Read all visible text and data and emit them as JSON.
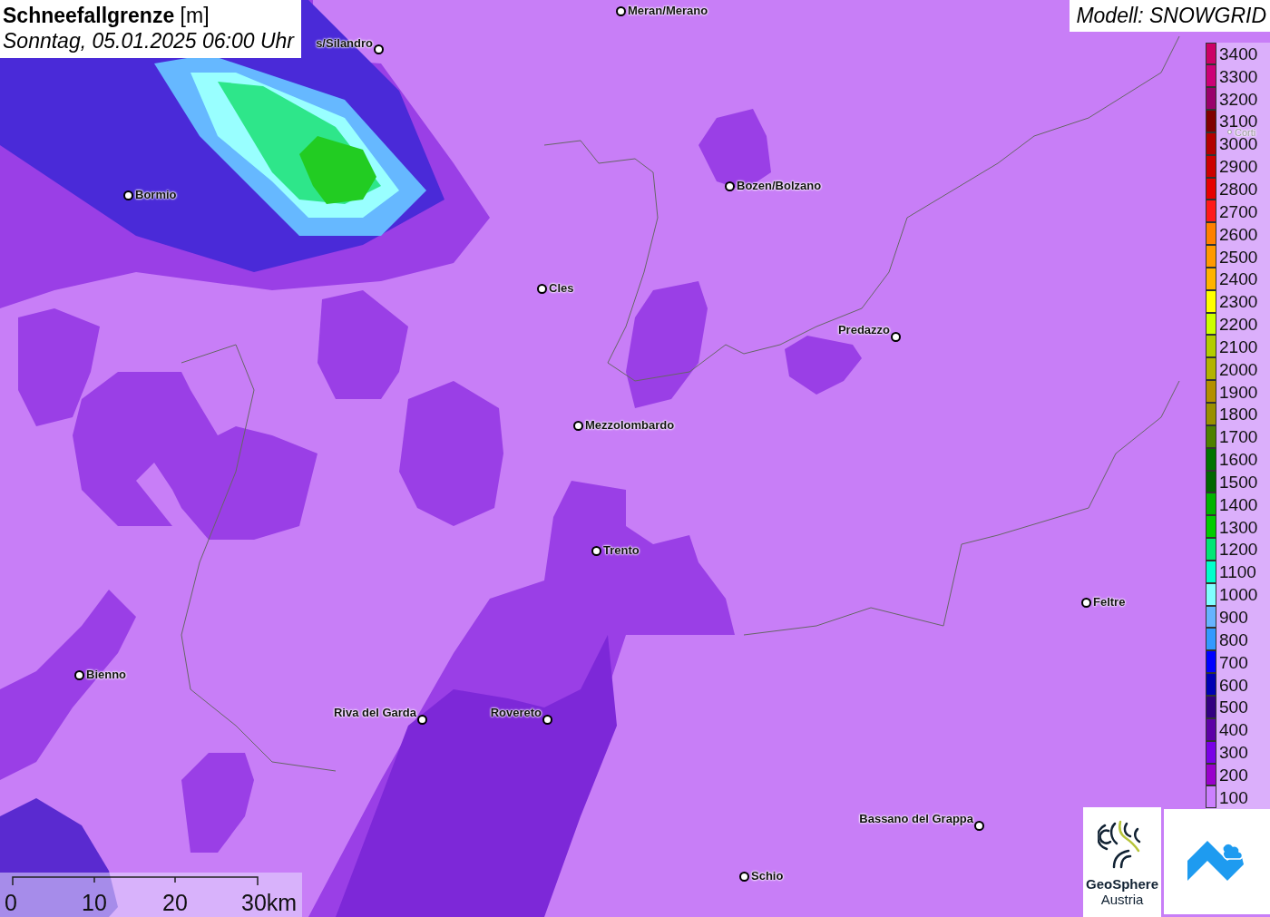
{
  "title": {
    "heading": "**Schneefallgrenze** [m]",
    "datetime": "Sonntag, 05.01.2025 06:00 Uhr"
  },
  "model": "Modell: SNOWGRID",
  "cities": [
    {
      "name": "Meran/Merano"
    },
    {
      "name": "s/Silandro"
    },
    {
      "name": "Bormio"
    },
    {
      "name": "Bozen/Bolzano"
    },
    {
      "name": "Cles"
    },
    {
      "name": "Predazzo"
    },
    {
      "name": "Mezzolombardo"
    },
    {
      "name": "Trento"
    },
    {
      "name": "Feltre"
    },
    {
      "name": "Bienno"
    },
    {
      "name": "Riva del Garda"
    },
    {
      "name": "Rovereto"
    },
    {
      "name": "Bassano del Grappa"
    },
    {
      "name": "Schio"
    },
    {
      "name": "Corti"
    }
  ],
  "legend": [
    {
      "label": "3400",
      "color": "#cc0066"
    },
    {
      "label": "3300",
      "color": "#cc0077"
    },
    {
      "label": "3200",
      "color": "#99006b"
    },
    {
      "label": "3100",
      "color": "#800000"
    },
    {
      "label": "3000",
      "color": "#b30000"
    },
    {
      "label": "2900",
      "color": "#cc0000"
    },
    {
      "label": "2800",
      "color": "#e60000"
    },
    {
      "label": "2700",
      "color": "#ff1a1a"
    },
    {
      "label": "2600",
      "color": "#ff8000"
    },
    {
      "label": "2500",
      "color": "#ff9900"
    },
    {
      "label": "2400",
      "color": "#ffb300"
    },
    {
      "label": "2300",
      "color": "#ffff00"
    },
    {
      "label": "2200",
      "color": "#ccff00"
    },
    {
      "label": "2100",
      "color": "#b3cc00"
    },
    {
      "label": "2000",
      "color": "#b3b300"
    },
    {
      "label": "1900",
      "color": "#b38f00"
    },
    {
      "label": "1800",
      "color": "#998f00"
    },
    {
      "label": "1700",
      "color": "#4d8000"
    },
    {
      "label": "1600",
      "color": "#007300"
    },
    {
      "label": "1500",
      "color": "#006600"
    },
    {
      "label": "1400",
      "color": "#00b300"
    },
    {
      "label": "1300",
      "color": "#00cc00"
    },
    {
      "label": "1200",
      "color": "#00e676"
    },
    {
      "label": "1100",
      "color": "#00ffcc"
    },
    {
      "label": "1000",
      "color": "#80ffff"
    },
    {
      "label": "900",
      "color": "#66b3ff"
    },
    {
      "label": "800",
      "color": "#3399ff"
    },
    {
      "label": "700",
      "color": "#0000ff"
    },
    {
      "label": "600",
      "color": "#0000b3"
    },
    {
      "label": "500",
      "color": "#330080"
    },
    {
      "label": "400",
      "color": "#5c00a6"
    },
    {
      "label": "300",
      "color": "#7a00e6"
    },
    {
      "label": "200",
      "color": "#9900cc"
    },
    {
      "label": "100",
      "color": "#cc80ff"
    }
  ],
  "scale": [
    "0",
    "10",
    "20",
    "30km"
  ],
  "logos": {
    "name": "GeoSphere",
    "subtitle": "Austria"
  }
}
